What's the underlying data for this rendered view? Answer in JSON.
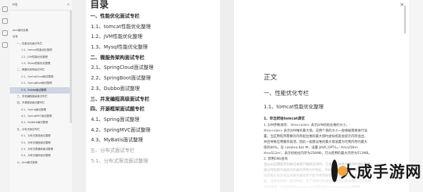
{
  "sidebar": {
    "title": "书签",
    "close": "✕",
    "items": [
      {
        "label": "Java面试合集",
        "level": 1
      },
      {
        "label": "目录",
        "level": 1
      },
      {
        "label": "一、性能优化面试专栏",
        "level": 2
      },
      {
        "label": "1.1、tomcat性能优化整理",
        "level": 3
      },
      {
        "label": "1.2、JVM性能优化整理",
        "level": 3
      },
      {
        "label": "1.3、Mysql性能优化整理",
        "level": 3
      },
      {
        "label": "二、微服务架构面试专栏",
        "level": 2
      },
      {
        "label": "2.1、SpringCloud面试整理",
        "level": 3
      },
      {
        "label": "2.2、SpringBoot面试整理",
        "level": 3
      },
      {
        "label": "2.3、Dubbo面试整理",
        "level": 3,
        "active": true
      },
      {
        "label": "三、并发编程高级面试专栏",
        "level": 2
      },
      {
        "label": "四、开源框架面试题专栏",
        "level": 2
      },
      {
        "label": "4.1、Spring面试整理",
        "level": 3
      },
      {
        "label": "4.2、SpringMVC面试整理",
        "level": 3
      },
      {
        "label": "4.3、MyBatis面试整理",
        "level": 3
      },
      {
        "label": "五、分布式面试专栏",
        "level": 2
      },
      {
        "label": "5.1、分布式限流面试整理",
        "level": 3
      },
      {
        "label": "5.2、分布式通信面试整理",
        "level": 3
      },
      {
        "label": "5.3、分布式数据库面试整理",
        "level": 3
      },
      {
        "label": "5.4、分布式缓存面试整理",
        "level": 3
      },
      {
        "label": "六、Java面试宝典",
        "level": 2
      }
    ]
  },
  "toc": {
    "heading": "目录",
    "items": [
      {
        "label": "一、性能优化面试专栏",
        "kind": "sec"
      },
      {
        "label": "1.1、tomcat性能优化整理",
        "kind": "sub"
      },
      {
        "label": "1.2、JVM性能优化整理",
        "kind": "sub"
      },
      {
        "label": "1.3、Mysql性能优化整理",
        "kind": "sub"
      },
      {
        "label": "二、微服务架构面试专栏",
        "kind": "sec"
      },
      {
        "label": "2.1、SpringCloud面试整理",
        "kind": "sub"
      },
      {
        "label": "2.2、SpringBoot面试整理",
        "kind": "sub"
      },
      {
        "label": "2.3、Dubbo面试整理",
        "kind": "sub"
      },
      {
        "label": "三、并发编程高级面试专栏",
        "kind": "sec"
      },
      {
        "label": "四、开源框架面试题专栏",
        "kind": "sec"
      },
      {
        "label": "4.1、Spring面试整理",
        "kind": "sub"
      },
      {
        "label": "4.2、SpringMVC面试整理",
        "kind": "sub"
      },
      {
        "label": "4.3、MyBatis面试整理",
        "kind": "sub"
      },
      {
        "label": "五、分布式面试专栏",
        "kind": "sec faded"
      },
      {
        "label": "5.1、分布式限流面试整理",
        "kind": "sub faded"
      }
    ]
  },
  "content": {
    "zhengwen": "正文",
    "h1": "一、性能优化专栏",
    "h2": "1.1、tomcat性能优化整理",
    "h3": "1、你怎样给tomcat调优",
    "lines": [
      "1. JVM参数调优：-Xms<size> 表示JVM初始化堆的大小，-",
      "Xmx<size> 表示JVM堆的最大值。这两个值的大小一般根据需要进行设",
      "置。当应用程序需要的内存超出堆的最大值时虚拟机就会提示内存溢出，",
      "并且导致应用服务崩溃。因此一般建议堆的最大值设置为可用内存的最大",
      "值的80%。在 catalina.bat 中，设置 JAVA_OPTS='-Xms256m-",
      "Xmx512m'，表示初始化内存为256MB，可以使用的最大内存为512MB。",
      "2. 禁用DNS查询",
      "当web应用程序向要记录客户端的信息时，它也会记录客户端的IP地址或者",
      "通过域名服务器查找机器名转换为IP地址。DNS查询需要占用网络，并且包",
      "括可能从很多很远的服务器或者不起作用的服务器上去获取对应的IP的过",
      "程，这样会消耗一定的时间。为了消除DNS查询对性能的影响我们可以关闭",
      "DNS查询，方式是修改server.xml文件中的enableLookups参数值"
    ]
  },
  "watermark": {
    "text": "大成手游网"
  }
}
